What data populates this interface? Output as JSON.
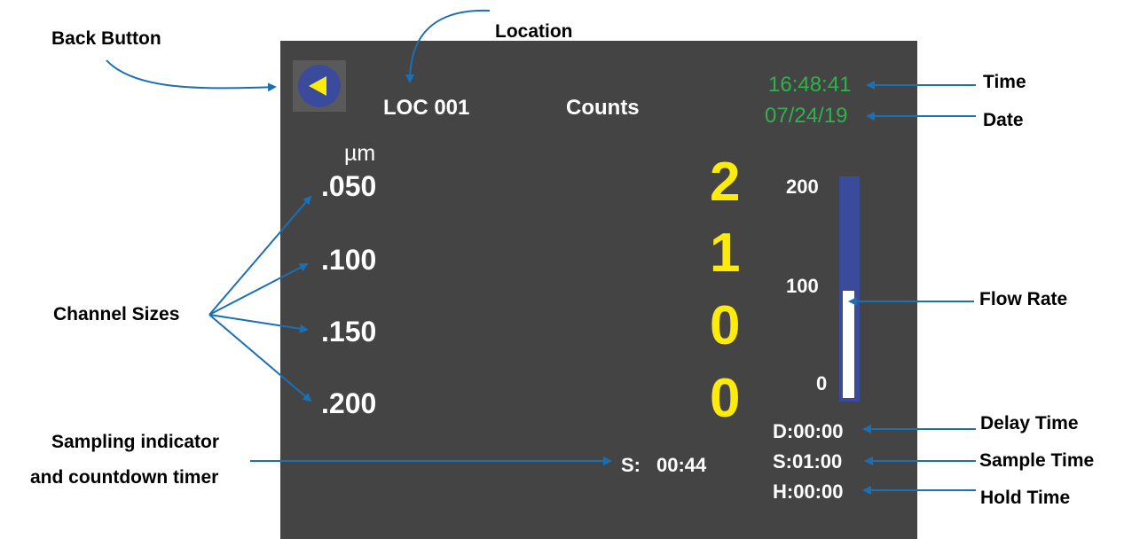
{
  "callouts": {
    "back_button": "Back Button",
    "location": "Location",
    "time": "Time",
    "date": "Date",
    "flow_rate": "Flow Rate",
    "channel_sizes": "Channel Sizes",
    "sampling_line1": "Sampling indicator",
    "sampling_line2": "and countdown timer",
    "delay_time": "Delay Time",
    "sample_time": "Sample Time",
    "hold_time": "Hold Time"
  },
  "screen": {
    "location": "LOC 001",
    "mode": "Counts",
    "time": "16:48:41",
    "date": "07/24/19",
    "unit": "µm",
    "channels": [
      {
        "size": ".050",
        "count": "2"
      },
      {
        "size": ".100",
        "count": "1"
      },
      {
        "size": ".150",
        "count": "0"
      },
      {
        "size": ".200",
        "count": "0"
      }
    ],
    "flow": {
      "scale_top": "200",
      "scale_mid": "100",
      "scale_bottom": "0",
      "max": 200,
      "value": 98
    },
    "sampling": {
      "label": "S:",
      "countdown": "00:44"
    },
    "delay": "D:00:00",
    "sample": "S:01:00",
    "hold": "H:00:00"
  },
  "colors": {
    "screen_bg": "#444444",
    "time_green": "#2fb24c",
    "count_yellow": "#ffeb0a",
    "flow_bar_blue": "#3a4b9b",
    "back_button_blue": "#3a4b9b",
    "arrow_blue": "#1a6fb5"
  },
  "icons": {
    "back": "triangle-left-icon"
  }
}
